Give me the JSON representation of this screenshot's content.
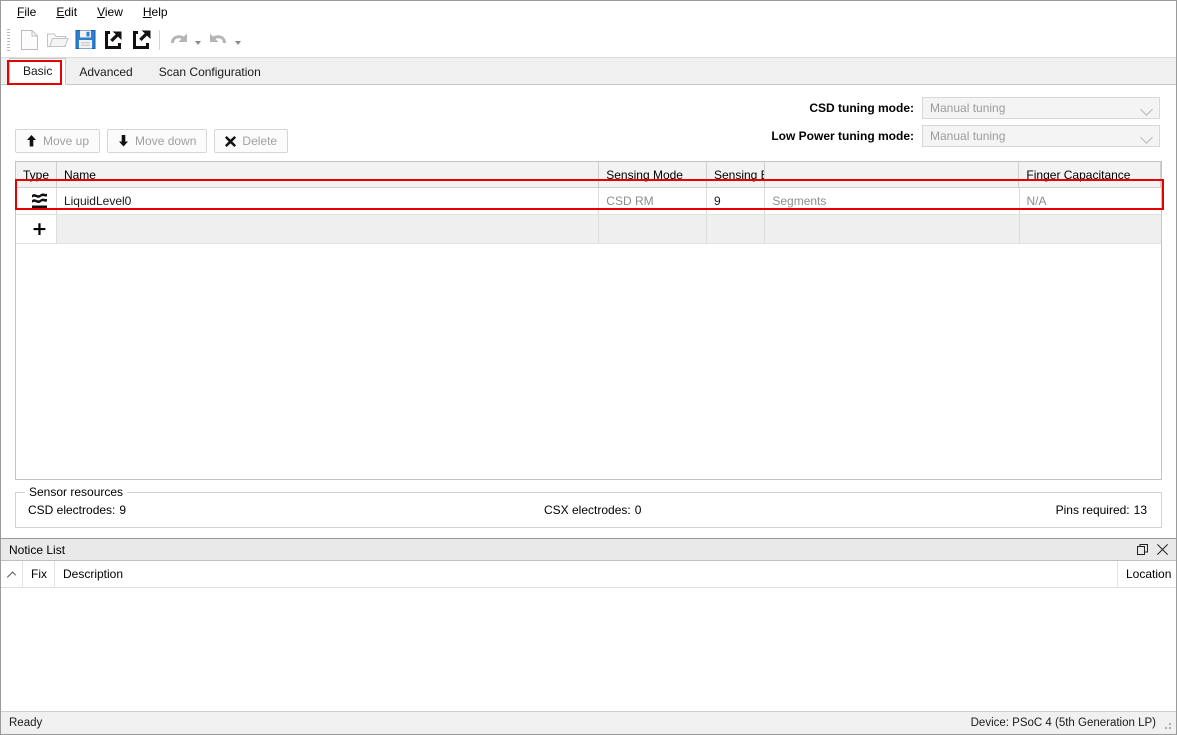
{
  "menubar": {
    "items": [
      {
        "label": "File",
        "accel": "F"
      },
      {
        "label": "Edit",
        "accel": "E"
      },
      {
        "label": "View",
        "accel": "V"
      },
      {
        "label": "Help",
        "accel": "H"
      }
    ]
  },
  "toolbar": {
    "buttons": [
      {
        "name": "new-file-icon",
        "enabled": false
      },
      {
        "name": "open-folder-icon",
        "enabled": false
      },
      {
        "name": "save-icon",
        "enabled": true
      },
      {
        "name": "import-icon",
        "enabled": true
      },
      {
        "name": "export-icon",
        "enabled": true
      },
      {
        "name": "undo-icon",
        "enabled": false
      },
      {
        "name": "redo-icon",
        "enabled": false
      }
    ]
  },
  "tabs": [
    {
      "label": "Basic",
      "active": true
    },
    {
      "label": "Advanced",
      "active": false
    },
    {
      "label": "Scan Configuration",
      "active": false
    }
  ],
  "tuning": {
    "csd_label": "CSD tuning mode:",
    "csd_value": "Manual tuning",
    "lowpower_label": "Low Power tuning mode:",
    "lowpower_value": "Manual tuning"
  },
  "actions": {
    "move_up": "Move up",
    "move_down": "Move down",
    "delete": "Delete"
  },
  "table": {
    "columns": [
      "Type",
      "Name",
      "Sensing Mode",
      "Sensing Element(s)",
      "",
      "Finger Capacitance"
    ],
    "rows": [
      {
        "type_icon": "liquid-level-icon",
        "name": "LiquidLevel0",
        "sensing_mode": "CSD RM",
        "element_count": "9",
        "element_label": "Segments",
        "finger_capacitance": "N/A"
      }
    ],
    "add_row_glyph": "+"
  },
  "sensor_resources": {
    "legend": "Sensor resources",
    "csd_label": "CSD electrodes:",
    "csd_value": "9",
    "csx_label": "CSX electrodes:",
    "csx_value": "0",
    "pins_label": "Pins required:",
    "pins_value": "13"
  },
  "notice_list": {
    "title": "Notice List",
    "columns": {
      "fix": "Fix",
      "description": "Description",
      "location": "Location"
    },
    "float_icon": "float-window-icon",
    "close_icon": "close-icon"
  },
  "statusbar": {
    "left": "Ready",
    "right": "Device: PSoC 4 (5th Generation LP)"
  },
  "colors": {
    "annotation": "#e60000",
    "save_blue": "#1b6fc4"
  }
}
